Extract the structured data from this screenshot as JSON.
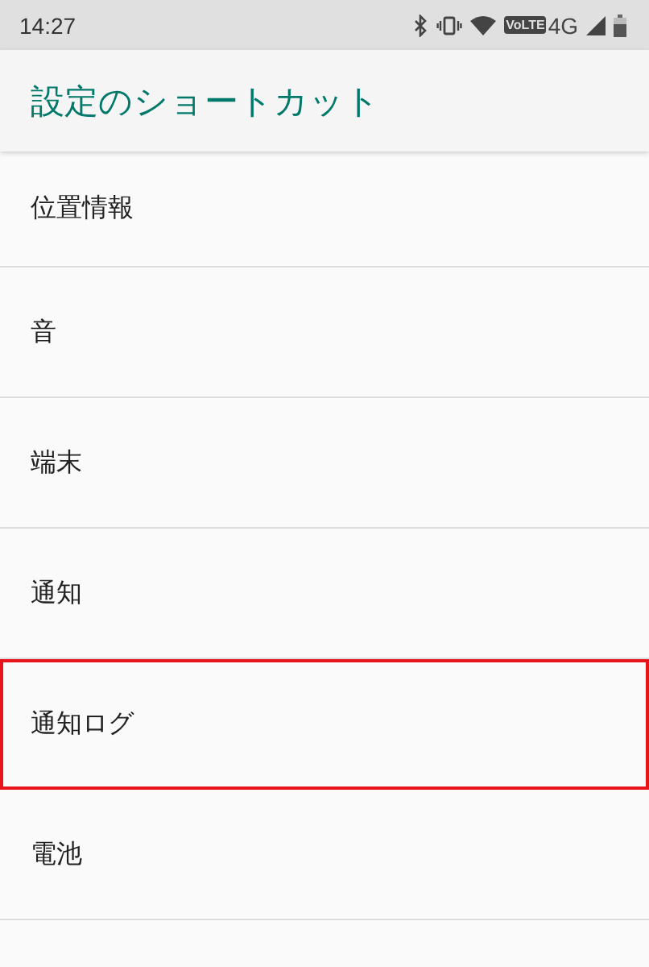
{
  "status_bar": {
    "time": "14:27",
    "volte": "VoLTE",
    "network": "4G"
  },
  "app_bar": {
    "title": "設定のショートカット"
  },
  "items": [
    {
      "label": "位置情報",
      "highlighted": false
    },
    {
      "label": "音",
      "highlighted": false
    },
    {
      "label": "端末",
      "highlighted": false
    },
    {
      "label": "通知",
      "highlighted": false
    },
    {
      "label": "通知ログ",
      "highlighted": true
    },
    {
      "label": "電池",
      "highlighted": false
    }
  ]
}
